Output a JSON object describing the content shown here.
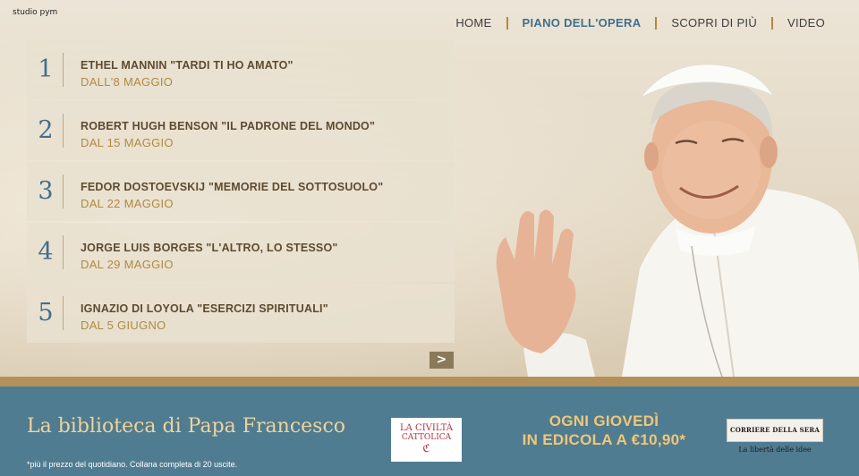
{
  "brand": "studio pym",
  "nav": {
    "items": [
      {
        "label": "HOME",
        "active": false
      },
      {
        "label": "PIANO DELL'OPERA",
        "active": true
      },
      {
        "label": "SCOPRI DI PIÙ",
        "active": false
      },
      {
        "label": "VIDEO",
        "active": false
      }
    ]
  },
  "books": [
    {
      "num": "1",
      "title": "ETHEL MANNIN \"TARDI TI HO AMATO\"",
      "date": "DALL'8 MAGGIO"
    },
    {
      "num": "2",
      "title": "ROBERT HUGH BENSON \"IL PADRONE DEL MONDO\"",
      "date": "DAL 15 MAGGIO"
    },
    {
      "num": "3",
      "title": "FEDOR DOSTOEVSKIJ \"MEMORIE DEL SOTTOSUOLO\"",
      "date": "DAL 22 MAGGIO"
    },
    {
      "num": "4",
      "title": "JORGE LUIS BORGES \"L'ALTRO, LO STESSO\"",
      "date": "DAL 29 MAGGIO"
    },
    {
      "num": "5",
      "title": "IGNAZIO DI LOYOLA \"ESERCIZI SPIRITUALI\"",
      "date": "DAL 5 GIUGNO"
    }
  ],
  "next_label": ">",
  "footer": {
    "title": "La biblioteca di Papa Francesco",
    "footnote": "*più il prezzo del quotidiano. Collana completa di 20 uscite.",
    "civilta_line1": "LA CIVILTÀ",
    "civilta_line2": "CATTOLICA",
    "civilta_mark": "ℭ",
    "promo_line1": "OGNI GIOVEDÌ",
    "promo_line2": "IN EDICOLA A €10,90*",
    "corriere_masthead": "CORRIERE DELLA SERA",
    "corriere_tagline": "La libertà delle idee"
  },
  "colors": {
    "accent_blue": "#3f6f8d",
    "gold": "#b08a40",
    "footer_bg": "#4f7c91",
    "promo_text": "#f0c778"
  },
  "icons": {
    "next": "next-arrow-icon"
  }
}
